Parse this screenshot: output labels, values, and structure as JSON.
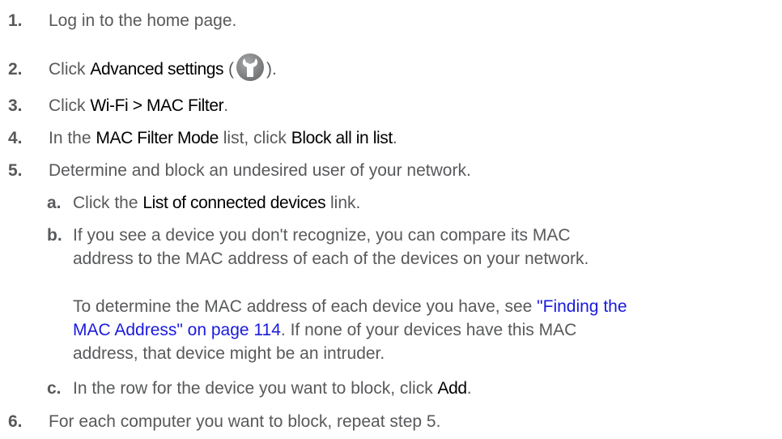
{
  "steps": [
    {
      "num": "1.",
      "text": "Log in to the home page."
    },
    {
      "num": "2.",
      "pre": "Click ",
      "ui": "Advanced settings",
      "open": " (",
      "close": ").",
      "icon": "wrench-icon"
    },
    {
      "num": "3.",
      "pre": "Click ",
      "ui": "Wi-Fi > MAC Filter",
      "post": "."
    },
    {
      "num": "4.",
      "pre": "In the ",
      "ui": "MAC Filter Mode",
      "mid": " list, click ",
      "ui2": "Block all in list",
      "post": "."
    },
    {
      "num": "5.",
      "text": "Determine and block an undesired user of your network."
    },
    {
      "num": "6.",
      "text": "For each computer you want to block, repeat step 5."
    }
  ],
  "substeps": {
    "a": {
      "num": "a.",
      "pre": "Click the ",
      "ui": "List of connected devices",
      "post": " link."
    },
    "b": {
      "num": "b.",
      "line1": "If you see a device you don't recognize, you can compare its MAC",
      "line2": "address to the MAC address of each of the devices on your network."
    },
    "note": {
      "line1_pre": "To determine the MAC address of each device you have, see ",
      "link1": "\"Finding the",
      "link2": "MAC Address\" on page 114",
      "line2_post": ". If none of your devices have this MAC",
      "line3": "address, that device might be an intruder."
    },
    "c": {
      "num": "c.",
      "pre": "In the row for the device you want to block, click ",
      "ui": "Add",
      "post": "."
    }
  },
  "colors": {
    "text": "#58595b",
    "ui_term": "#000000",
    "link": "#1a1adc",
    "icon": "#8a8b8d"
  }
}
